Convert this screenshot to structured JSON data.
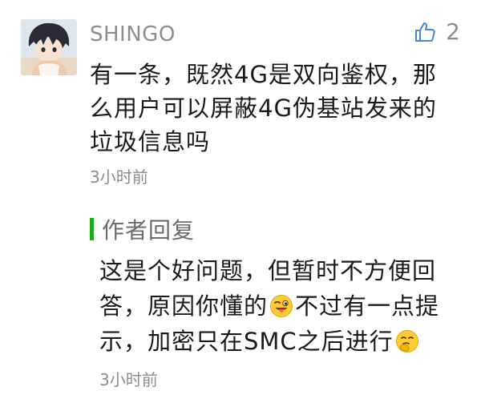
{
  "comment": {
    "username": "SHINGO",
    "like_count": "2",
    "text": "有一条，既然4G是双向鉴权，那么用户可以屏蔽4G伪基站发来的垃圾信息吗",
    "time": "3小时前"
  },
  "reply": {
    "title": "作者回复",
    "text_part1": "这是个好问题，但暂时不方便回答，原因你懂的",
    "emoji1": "tongue-wink-emoji",
    "text_part2": "不过有一点提示，加密只在SMC之后进行",
    "emoji2": "thinking-emoji",
    "time": "3小时前"
  },
  "colors": {
    "accent_green": "#1aad19",
    "meta_gray": "#8c8c8c",
    "text": "#1a1a1a",
    "reply_bg": "#ffffff"
  }
}
